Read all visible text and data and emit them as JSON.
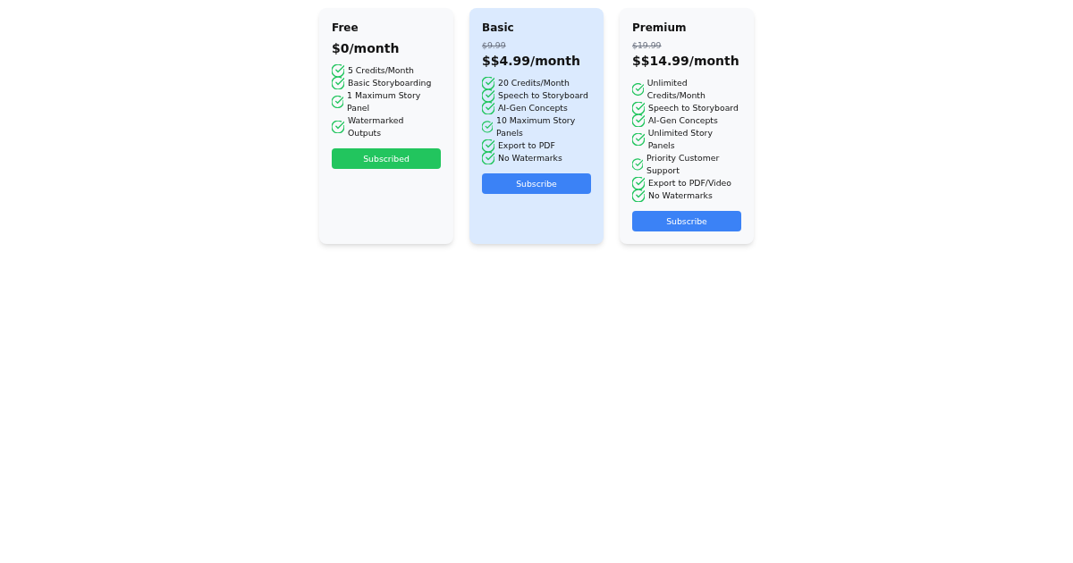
{
  "plans": [
    {
      "name": "Free",
      "highlighted": false,
      "price": "$0/month",
      "features": [
        "5 Credits/Month",
        "Basic Storyboarding",
        "1 Maximum Story Panel",
        "Watermarked Outputs"
      ],
      "button": {
        "label": "Subscribed",
        "current": true
      }
    },
    {
      "name": "Basic",
      "highlighted": true,
      "old_price": "$9.99",
      "price": "$$4.99/month",
      "features": [
        "20 Credits/Month",
        "Speech to Storyboard",
        "AI-Gen Concepts",
        "10 Maximum Story Panels",
        "Export to PDF",
        "No Watermarks"
      ],
      "button": {
        "label": "Subscribe",
        "current": false
      }
    },
    {
      "name": "Premium",
      "highlighted": false,
      "old_price": "$19.99",
      "price": "$$14.99/month",
      "features": [
        "Unlimited Credits/Month",
        "Speech to Storyboard",
        "AI-Gen Concepts",
        "Unlimited Story Panels",
        "Priority Customer Support",
        "Export to PDF/Video",
        "No Watermarks"
      ],
      "button": {
        "label": "Subscribe",
        "current": false
      }
    }
  ]
}
